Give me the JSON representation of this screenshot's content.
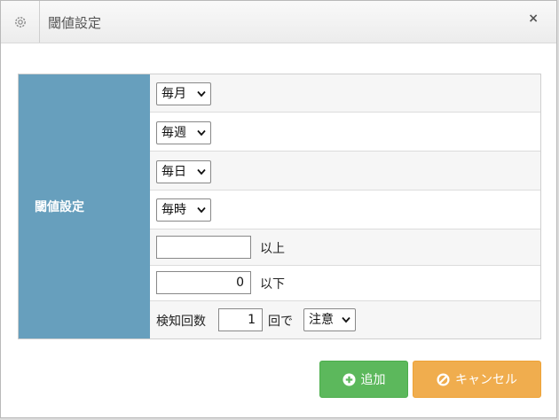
{
  "dialog": {
    "title": "閾値設定",
    "close_label": "×"
  },
  "form": {
    "section_label": "閾値設定",
    "monthly_select": "毎月",
    "weekly_select": "毎週",
    "daily_select": "毎日",
    "hourly_select": "毎時",
    "upper_value": "",
    "upper_suffix": "以上",
    "lower_value": "0",
    "lower_suffix": "以下",
    "detect_label": "検知回数",
    "detect_count": "1",
    "detect_suffix": "回で",
    "level_select": "注意"
  },
  "buttons": {
    "add_label": "追加",
    "cancel_label": "キャンセル"
  },
  "colors": {
    "label_cell": "#679fbd",
    "add_button": "#5cb85c",
    "cancel_button": "#f0ad4e"
  }
}
